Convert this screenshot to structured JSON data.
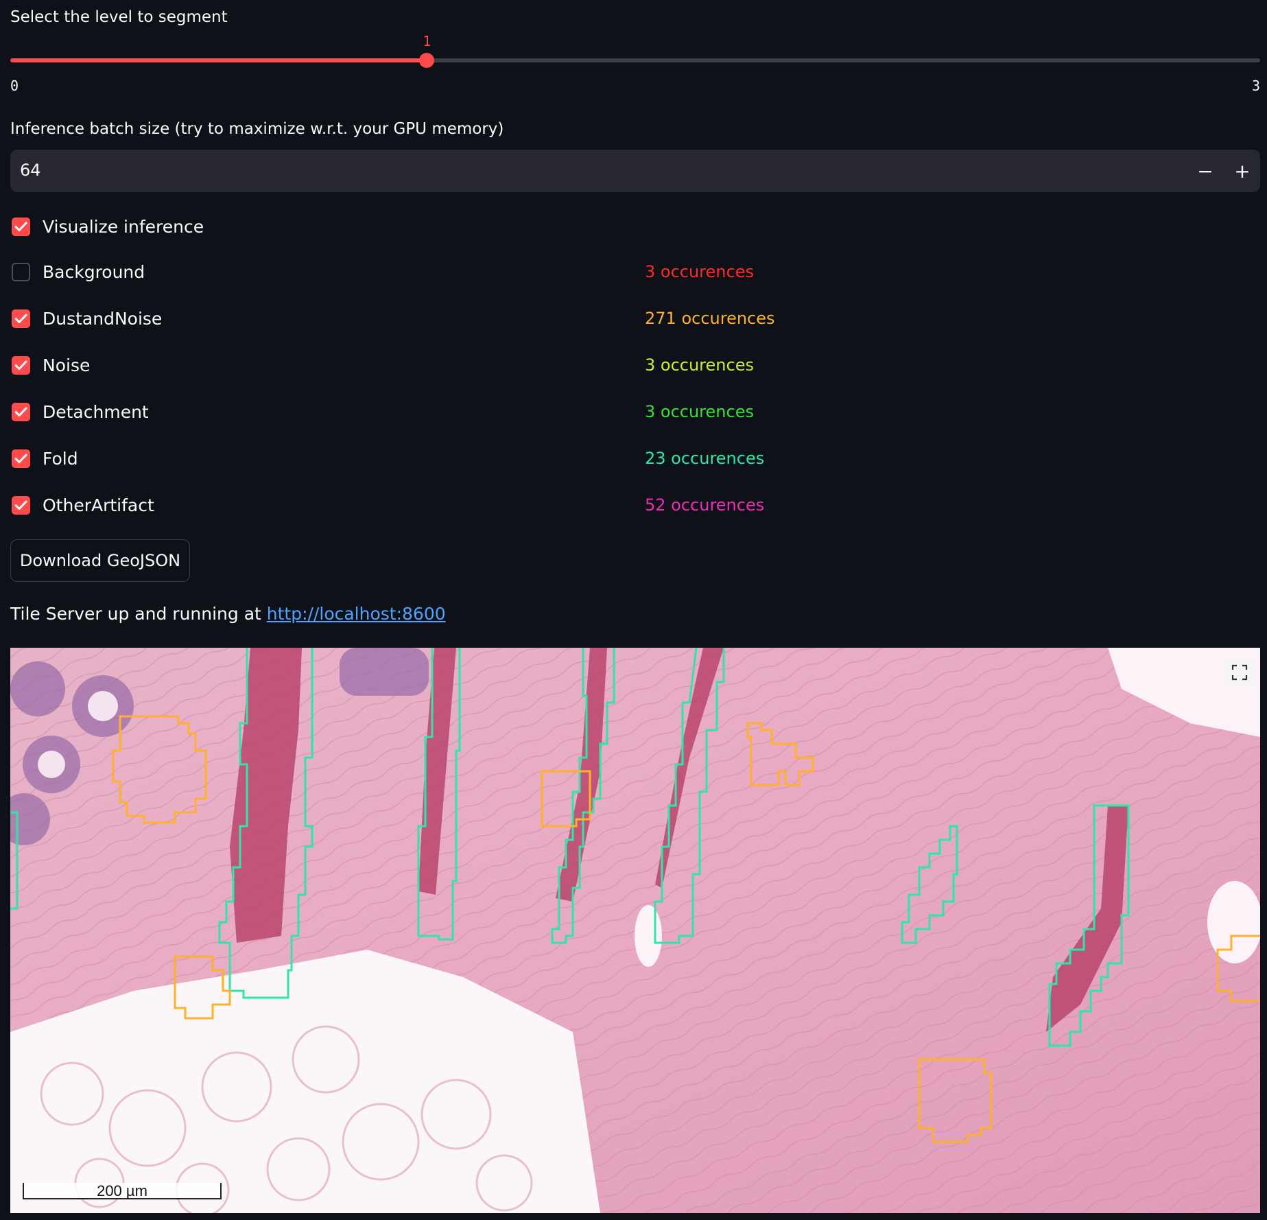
{
  "level_slider": {
    "label": "Select the level to segment",
    "value": 1,
    "min": 0,
    "max": 3,
    "min_label": "0",
    "max_label": "3",
    "value_label": "1",
    "accent_color": "#ff4b4b"
  },
  "batch_size": {
    "label": "Inference batch size (try to maximize w.r.t. your GPU memory)",
    "value": "64",
    "decrement_symbol": "−",
    "increment_symbol": "+"
  },
  "visualize": {
    "label": "Visualize inference",
    "checked": true
  },
  "classes": [
    {
      "label": "Background",
      "checked": false,
      "occurrences": "3 occurences",
      "color": "#ff2b2b"
    },
    {
      "label": "DustandNoise",
      "checked": true,
      "occurrences": "271 occurences",
      "color": "#ffb12b"
    },
    {
      "label": "Noise",
      "checked": true,
      "occurrences": "3 occurences",
      "color": "#c6f02b"
    },
    {
      "label": "Detachment",
      "checked": true,
      "occurrences": "3 occurences",
      "color": "#3ae03a"
    },
    {
      "label": "Fold",
      "checked": true,
      "occurrences": "23 occurences",
      "color": "#2be8a8"
    },
    {
      "label": "OtherArtifact",
      "checked": true,
      "occurrences": "52 occurences",
      "color": "#f02bb5"
    }
  ],
  "download_button": {
    "label": "Download GeoJSON"
  },
  "tile_server": {
    "prefix": "Tile Server up and running at ",
    "link_text": "http://localhost:8600"
  },
  "viewer": {
    "scale_label": "200 µm",
    "fullscreen_icon": "expand-icon",
    "fold_outline_color": "#2be8a8",
    "dust_outline_color": "#ffb12b"
  }
}
